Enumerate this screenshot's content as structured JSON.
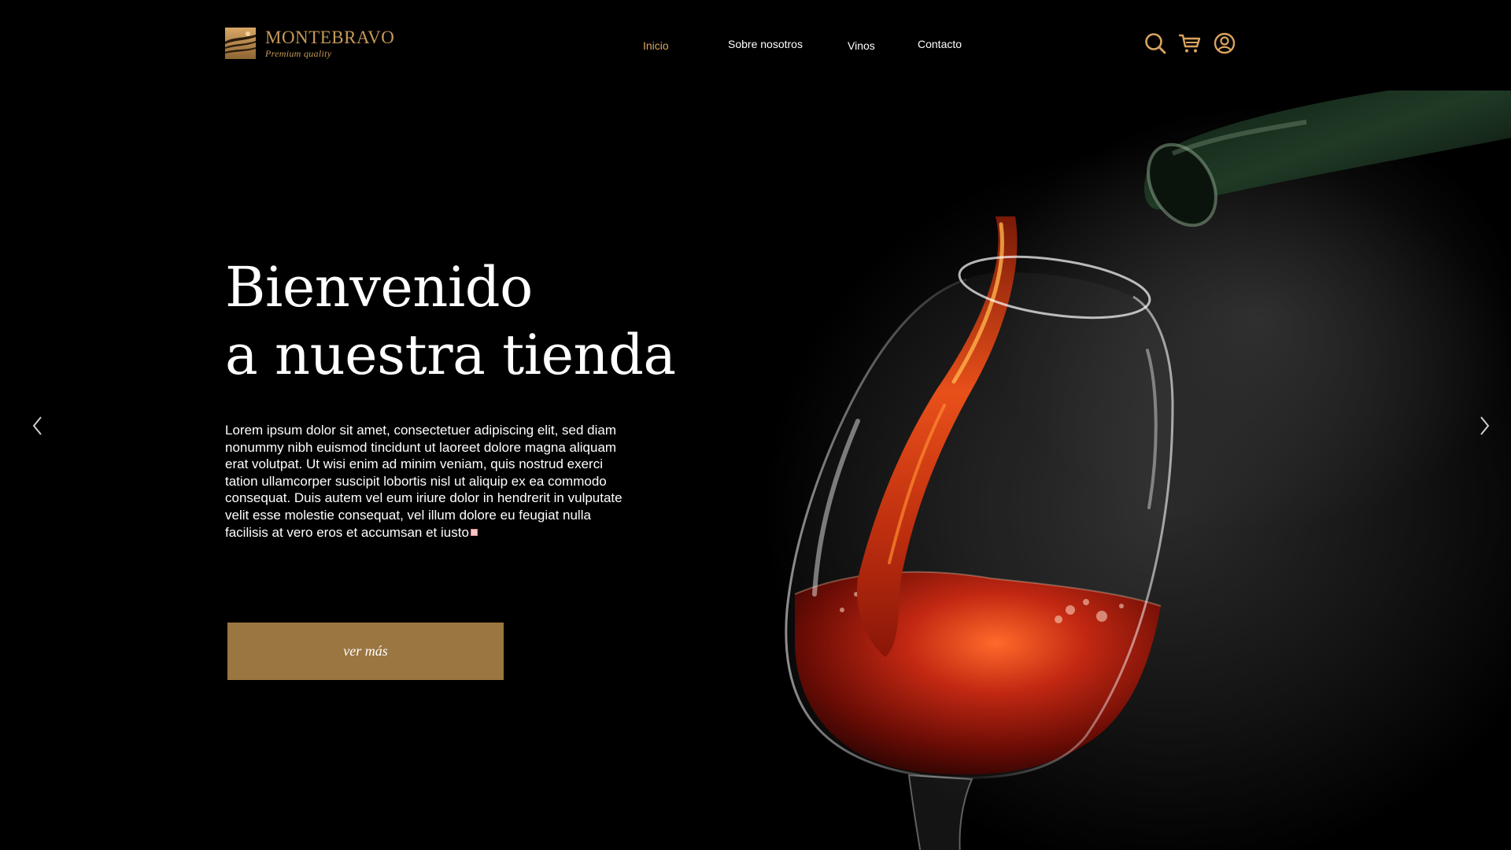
{
  "brand": {
    "name": "MONTEBRAVO",
    "tagline": "Premium quality",
    "accent_color": "#c79a59"
  },
  "nav": {
    "items": [
      {
        "label": "Inicio",
        "active": true
      },
      {
        "label": "Sobre nosotros",
        "active": false
      },
      {
        "label": "Vinos",
        "active": false
      },
      {
        "label": "Contacto",
        "active": false
      }
    ]
  },
  "header_icons": [
    "search-icon",
    "cart-icon",
    "user-account-icon"
  ],
  "hero": {
    "title_line1": "Bienvenido",
    "title_line2": "a nuestra tienda",
    "body": "Lorem ipsum dolor sit amet, consectetuer adipiscing elit, sed diam nonummy nibh euismod tincidunt ut laoreet dolore magna aliquam erat volutpat. Ut wisi enim ad minim veniam, quis nostrud exerci tation ullamcorper suscipit lobortis nisl ut aliquip ex ea commodo consequat. Duis autem vel eum iriure dolor in hendrerit in vulputate velit esse molestie consequat, vel illum dolore eu feugiat nulla facilisis at vero eros et accumsan et iusto",
    "cta_label": "ver más",
    "cta_color": "#9b7641",
    "image": "red-wine-pouring-into-glass"
  },
  "slider": {
    "prev_icon": "chevron-left-icon",
    "next_icon": "chevron-right-icon"
  }
}
